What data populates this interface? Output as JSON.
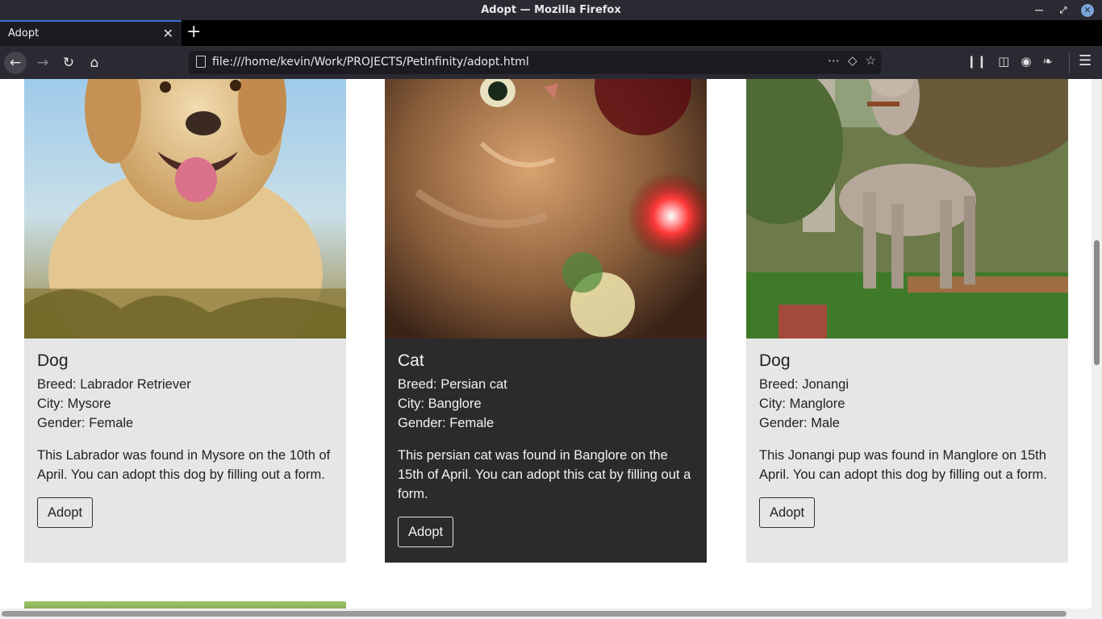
{
  "window": {
    "title": "Adopt — Mozilla Firefox"
  },
  "tabs": [
    {
      "label": "Adopt"
    }
  ],
  "address_bar": {
    "url": "file:///home/kevin/Work/PROJECTS/PetInfinity/adopt.html"
  },
  "cards": [
    {
      "title": "Dog",
      "breed": "Breed: Labrador Retriever",
      "city": "City: Mysore",
      "gender": "Gender: Female",
      "description": "This Labrador was found in Mysore on the 10th of April. You can adopt this dog by filling out a form.",
      "button": "Adopt",
      "theme": "light"
    },
    {
      "title": "Cat",
      "breed": "Breed: Persian cat",
      "city": "City: Banglore",
      "gender": "Gender: Female",
      "description": "This persian cat was found in Banglore on the 15th of April. You can adopt this cat by filling out a form.",
      "button": "Adopt",
      "theme": "dark"
    },
    {
      "title": "Dog",
      "breed": "Breed: Jonangi",
      "city": "City: Manglore",
      "gender": "Gender: Male",
      "description": "This Jonangi pup was found in Manglore on 15th April. You can adopt this dog by filling out a form.",
      "button": "Adopt",
      "theme": "light"
    }
  ],
  "colors": {
    "card_light": "#e6e6e6",
    "card_dark": "#2b2b2b",
    "browser_chrome": "#2b2a33",
    "tab_accent": "#3b6fd6"
  },
  "icons": [
    "minimize-icon",
    "maximize-icon",
    "close-icon",
    "back-arrow-icon",
    "forward-arrow-icon",
    "reload-icon",
    "home-icon",
    "page-icon",
    "more-icon",
    "pocket-icon",
    "bookmark-star-icon",
    "library-icon",
    "sidebar-icon",
    "globe-icon",
    "extension-icon",
    "hamburger-menu-icon"
  ]
}
